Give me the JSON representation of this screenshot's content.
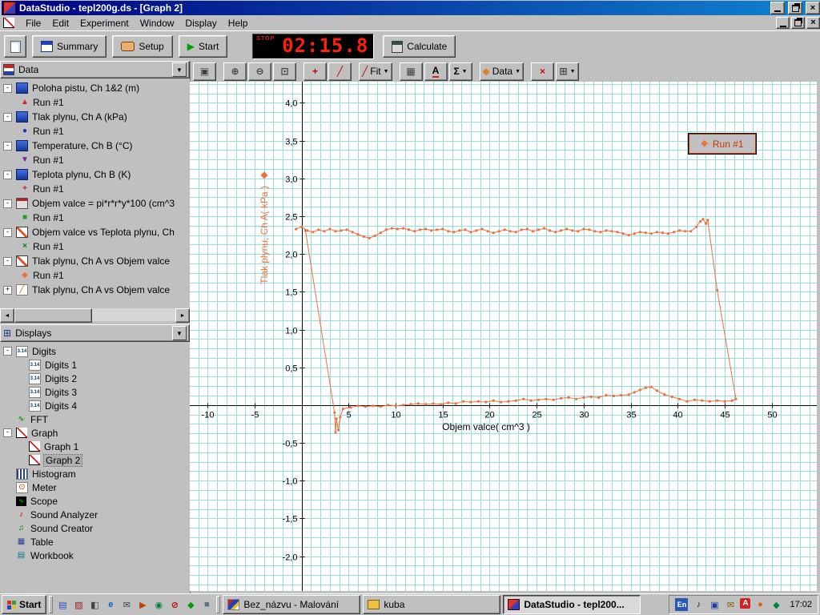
{
  "icons": {
    "dropdown": "▼",
    "scroll_left": "◄",
    "scroll_right": "►",
    "close": "×",
    "play": "▶"
  },
  "window": {
    "title": "DataStudio - tepl200g.ds - [Graph 2]"
  },
  "menu": {
    "items": [
      "File",
      "Edit",
      "Experiment",
      "Window",
      "Display",
      "Help"
    ]
  },
  "toolbar": {
    "summary": "Summary",
    "setup": "Setup",
    "start": "Start",
    "calculate": "Calculate",
    "timer": {
      "label": "STOP",
      "value": "02:15.8"
    }
  },
  "graph_toolbar": {
    "buttons": [
      {
        "name": "scale-to-fit-button",
        "glyph": "▣",
        "color": "#404040"
      },
      {
        "name": "zoom-in-button",
        "glyph": "⊕",
        "color": "#404040",
        "gap": true
      },
      {
        "name": "zoom-out-button",
        "glyph": "⊖",
        "color": "#404040"
      },
      {
        "name": "zoom-select-button",
        "glyph": "⊡",
        "color": "#404040"
      },
      {
        "name": "smart-tool-button",
        "glyph": "+",
        "color": "#c00000",
        "gap": true
      },
      {
        "name": "slope-tool-button",
        "glyph": "╱",
        "color": "#c00000"
      },
      {
        "name": "fit-menu-button",
        "glyph": "╱",
        "color": "#c00000",
        "label": "Fit",
        "dropdown": true,
        "gap": true
      },
      {
        "name": "calculate-tool-button",
        "glyph": "▦",
        "color": "#404040",
        "gap": true
      },
      {
        "name": "text-annotation-button",
        "glyph": "A",
        "color": "#000000",
        "underline": "#d02020"
      },
      {
        "name": "statistics-menu-button",
        "glyph": "Σ",
        "color": "#000000",
        "dropdown": true
      },
      {
        "name": "data-menu-button",
        "glyph": "◆",
        "color": "#e08020",
        "label": "Data",
        "dropdown": true,
        "gap": true
      },
      {
        "name": "delete-button",
        "glyph": "×",
        "color": "#d00000",
        "gap": true
      },
      {
        "name": "graph-settings-button",
        "glyph": "⊞",
        "color": "#404040",
        "dropdown": true
      }
    ]
  },
  "data_panel": {
    "title": "Data",
    "items": [
      {
        "type": "source",
        "label": "Poloha pistu, Ch 1&2 (m)",
        "icon": "sensor-icon",
        "exp": "-"
      },
      {
        "type": "run",
        "label": "Run #1",
        "glyph": "▲",
        "color": "#e02020"
      },
      {
        "type": "source",
        "label": "Tlak plynu, Ch A (kPa)",
        "icon": "sensor-icon",
        "exp": "-"
      },
      {
        "type": "run",
        "label": "Run #1",
        "glyph": "●",
        "color": "#2030c0"
      },
      {
        "type": "source",
        "label": "Temperature, Ch B (°C)",
        "icon": "sensor-icon",
        "exp": "-"
      },
      {
        "type": "run",
        "label": "Run #1",
        "glyph": "▼",
        "color": "#8020a0"
      },
      {
        "type": "source",
        "label": "Teplota plynu, Ch B (K)",
        "icon": "sensor-icon",
        "exp": "-"
      },
      {
        "type": "run",
        "label": "Run #1",
        "glyph": "+",
        "color": "#c02020"
      },
      {
        "type": "source",
        "label": "Objem valce = pi*r*r*y*100 (cm^3",
        "icon": "calc-icon",
        "exp": "-"
      },
      {
        "type": "run",
        "label": "Run #1",
        "glyph": "■",
        "color": "#20a020"
      },
      {
        "type": "source",
        "label": "Objem valce vs Teplota plynu, Ch",
        "icon": "xy-icon",
        "exp": "-"
      },
      {
        "type": "run",
        "label": "Run #1",
        "glyph": "×",
        "color": "#107010"
      },
      {
        "type": "source",
        "label": "Tlak plynu, Ch A vs Objem valce",
        "icon": "xy-icon",
        "exp": "-"
      },
      {
        "type": "run",
        "label": "Run #1",
        "glyph": "◆",
        "color": "#f0703c"
      },
      {
        "type": "source",
        "label": "Tlak plynu, Ch A vs Objem valce",
        "icon": "pen-icon",
        "glyph": "╱",
        "exp": "+"
      }
    ]
  },
  "displays_panel": {
    "title": "Displays",
    "items": [
      {
        "label": "Digits",
        "icon": "digits-icon",
        "glyph": "3.14",
        "indent": 0,
        "expand": true
      },
      {
        "label": "Digits 1",
        "icon": "digits-icon",
        "glyph": "3.14",
        "indent": 1
      },
      {
        "label": "Digits 2",
        "icon": "digits-icon",
        "glyph": "3.14",
        "indent": 1
      },
      {
        "label": "Digits 3",
        "icon": "digits-icon",
        "glyph": "3.14",
        "indent": 1
      },
      {
        "label": "Digits 4",
        "icon": "digits-icon",
        "glyph": "3.14",
        "indent": 1
      },
      {
        "label": "FFT",
        "icon": "fft-icon",
        "glyph": "∿",
        "indent": 0
      },
      {
        "label": "Graph",
        "icon": "graph-icon",
        "glyph": "",
        "indent": 0,
        "expand": true
      },
      {
        "label": "Graph 1",
        "icon": "graph-icon",
        "glyph": "",
        "indent": 1
      },
      {
        "label": "Graph 2",
        "icon": "graph-icon",
        "glyph": "",
        "indent": 1,
        "selected": true
      },
      {
        "label": "Histogram",
        "icon": "histogram-icon",
        "glyph": "",
        "indent": 0
      },
      {
        "label": "Meter",
        "icon": "meter-icon",
        "glyph": "⊙",
        "indent": 0
      },
      {
        "label": "Scope",
        "icon": "scope-icon",
        "glyph": "∿",
        "indent": 0
      },
      {
        "label": "Sound Analyzer",
        "icon": "sound-analyzer-icon",
        "glyph": "♪",
        "indent": 0
      },
      {
        "label": "Sound Creator",
        "icon": "sound-creator-icon",
        "glyph": "♫",
        "indent": 0
      },
      {
        "label": "Table",
        "icon": "table-icon",
        "glyph": "▦",
        "indent": 0
      },
      {
        "label": "Workbook",
        "icon": "workbook-icon",
        "glyph": "▤",
        "indent": 0
      }
    ]
  },
  "chart_data": {
    "type": "scatter",
    "title": "",
    "xlabel": "Objem valce( cm^3 )",
    "ylabel": "Tlak plynu, Ch A( kPa )",
    "series_name": "Run #1",
    "series_color": "#f0703c",
    "legend_marker": "◆",
    "xlim": [
      -11.9,
      54.8
    ],
    "ylim": [
      -2.46,
      4.28
    ],
    "grid": {
      "x_step": 1,
      "y_step": 0.125,
      "color": "#96dcdc"
    },
    "x_ticks": [
      -10,
      -5,
      5,
      10,
      15,
      20,
      25,
      30,
      35,
      40,
      45,
      50
    ],
    "x_tick_labels": [
      "-10",
      "-5",
      "5",
      "10",
      "15",
      "20",
      "25",
      "30",
      "35",
      "40",
      "45",
      "50"
    ],
    "y_ticks": [
      4,
      3.5,
      3,
      2.5,
      2,
      1.5,
      1,
      0.5,
      -0.5,
      -1,
      -1.5,
      -2
    ],
    "y_tick_labels": [
      "4,0",
      "3,5",
      "3,0",
      "2,5",
      "2,0",
      "1,5",
      "1,0",
      "0,5",
      "-0,5",
      "-1,0",
      "-1,5",
      "-2,0"
    ],
    "points": [
      [
        -0.6,
        2.33
      ],
      [
        0,
        2.36
      ],
      [
        0.6,
        2.31
      ],
      [
        1.2,
        2.29
      ],
      [
        1.8,
        2.32
      ],
      [
        2.4,
        2.3
      ],
      [
        3,
        2.33
      ],
      [
        3.6,
        2.3
      ],
      [
        4.2,
        2.31
      ],
      [
        4.8,
        2.32
      ],
      [
        5.4,
        2.29
      ],
      [
        6,
        2.26
      ],
      [
        6.6,
        2.23
      ],
      [
        7.2,
        2.21
      ],
      [
        7.8,
        2.24
      ],
      [
        8.4,
        2.28
      ],
      [
        9,
        2.32
      ],
      [
        9.6,
        2.34
      ],
      [
        10.2,
        2.33
      ],
      [
        10.8,
        2.34
      ],
      [
        11.4,
        2.32
      ],
      [
        12,
        2.3
      ],
      [
        12.6,
        2.32
      ],
      [
        13.2,
        2.33
      ],
      [
        13.8,
        2.31
      ],
      [
        14.4,
        2.32
      ],
      [
        15,
        2.33
      ],
      [
        15.6,
        2.3
      ],
      [
        16.2,
        2.29
      ],
      [
        16.8,
        2.31
      ],
      [
        17.4,
        2.32
      ],
      [
        18,
        2.29
      ],
      [
        18.6,
        2.31
      ],
      [
        19.2,
        2.33
      ],
      [
        19.8,
        2.3
      ],
      [
        20.4,
        2.28
      ],
      [
        21,
        2.3
      ],
      [
        21.6,
        2.32
      ],
      [
        22.2,
        2.3
      ],
      [
        22.8,
        2.29
      ],
      [
        23.4,
        2.32
      ],
      [
        24,
        2.33
      ],
      [
        24.6,
        2.3
      ],
      [
        25.2,
        2.32
      ],
      [
        25.8,
        2.34
      ],
      [
        26.4,
        2.31
      ],
      [
        27,
        2.29
      ],
      [
        27.6,
        2.31
      ],
      [
        28.2,
        2.33
      ],
      [
        28.8,
        2.31
      ],
      [
        29.4,
        2.3
      ],
      [
        30,
        2.33
      ],
      [
        30.6,
        2.32
      ],
      [
        31.2,
        2.3
      ],
      [
        31.8,
        2.29
      ],
      [
        32.4,
        2.31
      ],
      [
        33,
        2.3
      ],
      [
        33.6,
        2.29
      ],
      [
        34.2,
        2.27
      ],
      [
        34.8,
        2.25
      ],
      [
        35.4,
        2.27
      ],
      [
        36,
        2.29
      ],
      [
        36.6,
        2.28
      ],
      [
        37.2,
        2.27
      ],
      [
        37.8,
        2.29
      ],
      [
        38.4,
        2.28
      ],
      [
        39,
        2.27
      ],
      [
        39.6,
        2.29
      ],
      [
        40.2,
        2.31
      ],
      [
        40.8,
        2.3
      ],
      [
        41.4,
        2.3
      ],
      [
        42,
        2.36
      ],
      [
        42.4,
        2.43
      ],
      [
        42.7,
        2.46
      ],
      [
        43,
        2.4
      ],
      [
        43.2,
        2.45
      ],
      [
        44.2,
        1.52
      ],
      [
        46.2,
        0.08
      ],
      [
        45.8,
        0.06
      ],
      [
        45,
        0.05
      ],
      [
        44.2,
        0.06
      ],
      [
        43.4,
        0.05
      ],
      [
        42.6,
        0.06
      ],
      [
        41.8,
        0.07
      ],
      [
        41,
        0.05
      ],
      [
        40.2,
        0.08
      ],
      [
        39.4,
        0.11
      ],
      [
        38.6,
        0.14
      ],
      [
        37.8,
        0.19
      ],
      [
        37.2,
        0.24
      ],
      [
        36.6,
        0.23
      ],
      [
        36,
        0.2
      ],
      [
        35.4,
        0.17
      ],
      [
        34.8,
        0.14
      ],
      [
        34,
        0.13
      ],
      [
        33.2,
        0.12
      ],
      [
        32.4,
        0.13
      ],
      [
        31.6,
        0.1
      ],
      [
        30.8,
        0.11
      ],
      [
        30,
        0.1
      ],
      [
        29.2,
        0.08
      ],
      [
        28.4,
        0.1
      ],
      [
        27.6,
        0.09
      ],
      [
        26.8,
        0.07
      ],
      [
        26,
        0.08
      ],
      [
        25.2,
        0.07
      ],
      [
        24.4,
        0.06
      ],
      [
        23.6,
        0.08
      ],
      [
        22.8,
        0.06
      ],
      [
        22,
        0.05
      ],
      [
        21.2,
        0.04
      ],
      [
        20.4,
        0.06
      ],
      [
        19.6,
        0.04
      ],
      [
        18.8,
        0.05
      ],
      [
        18,
        0.04
      ],
      [
        17.2,
        0.05
      ],
      [
        16.4,
        0.02
      ],
      [
        15.6,
        0.03
      ],
      [
        14.8,
        0.01
      ],
      [
        14,
        0.02
      ],
      [
        13.2,
        0.01
      ],
      [
        12.4,
        0.02
      ],
      [
        11.6,
        0.01
      ],
      [
        10.8,
        0
      ],
      [
        10,
        -0.01
      ],
      [
        9.2,
        0
      ],
      [
        8.4,
        -0.02
      ],
      [
        7.6,
        -0.01
      ],
      [
        6.8,
        -0.02
      ],
      [
        6,
        -0.01
      ],
      [
        5.2,
        -0.03
      ],
      [
        4.4,
        -0.05
      ],
      [
        4.1,
        -0.16
      ],
      [
        3.9,
        -0.33
      ],
      [
        3.7,
        -0.18
      ],
      [
        3.6,
        -0.36
      ],
      [
        3.5,
        -0.1
      ],
      [
        0.4,
        2.31
      ]
    ]
  },
  "taskbar": {
    "start_label": "Start",
    "quicklaunch": [
      {
        "name": "notepad-icon",
        "glyph": "▤",
        "color": "#3050c0"
      },
      {
        "name": "paint-icon",
        "glyph": "▨",
        "color": "#a02020"
      },
      {
        "name": "wordpad-icon",
        "glyph": "◧",
        "color": "#404040"
      },
      {
        "name": "ie-icon",
        "glyph": "e",
        "color": "#1060c0"
      },
      {
        "name": "mail-icon",
        "glyph": "✉",
        "color": "#404040"
      },
      {
        "name": "media-player-icon",
        "glyph": "▶",
        "color": "#c04000"
      },
      {
        "name": "globe-icon",
        "glyph": "◉",
        "color": "#008040"
      },
      {
        "name": "blocked-icon",
        "glyph": "⊘",
        "color": "#c00000"
      },
      {
        "name": "green-app-icon",
        "glyph": "◆",
        "color": "#00a000"
      },
      {
        "name": "gray-app-icon",
        "glyph": "■",
        "color": "#607080"
      }
    ],
    "tasks": [
      {
        "name": "task-paint",
        "label": "Bez_názvu - Malování",
        "icon": "paint-icon",
        "active": false
      },
      {
        "name": "task-folder-kuba",
        "label": "kuba",
        "icon": "folder-icon",
        "active": false
      },
      {
        "name": "task-datastudio",
        "label": "DataStudio - tepl200...",
        "icon": "datastudio-icon",
        "active": true
      }
    ],
    "tray": {
      "language_indicator": "En",
      "icons": [
        {
          "name": "volume-icon",
          "glyph": "♪",
          "color": "#202020"
        },
        {
          "name": "display-settings-icon",
          "glyph": "▣",
          "color": "#2040a0"
        },
        {
          "name": "mail-notify-icon",
          "glyph": "✉",
          "color": "#806000"
        },
        {
          "name": "antivirus-icon",
          "glyph": "A",
          "color": "#ffffff",
          "badge": true
        },
        {
          "name": "status-icon",
          "glyph": "●",
          "color": "#e06000"
        },
        {
          "name": "network-icon",
          "glyph": "◆",
          "color": "#008040"
        }
      ],
      "time": "17:02"
    }
  }
}
